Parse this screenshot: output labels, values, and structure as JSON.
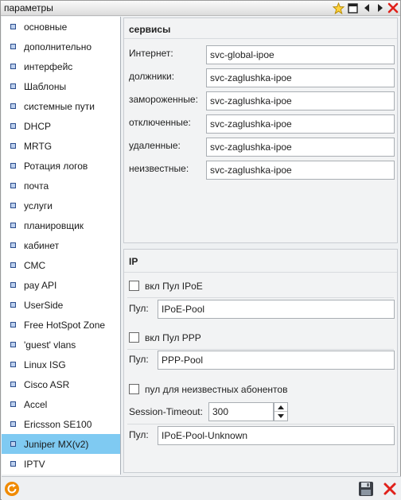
{
  "window": {
    "title": "параметры"
  },
  "sidebar": {
    "selected_index": 21,
    "items": [
      {
        "label": "основные"
      },
      {
        "label": "дополнительно"
      },
      {
        "label": "интерфейс"
      },
      {
        "label": "Шаблоны"
      },
      {
        "label": "системные пути"
      },
      {
        "label": "DHCP"
      },
      {
        "label": "MRTG"
      },
      {
        "label": "Ротация логов"
      },
      {
        "label": "почта"
      },
      {
        "label": "услуги"
      },
      {
        "label": "планировщик"
      },
      {
        "label": "кабинет"
      },
      {
        "label": "СМС"
      },
      {
        "label": "pay API"
      },
      {
        "label": "UserSide"
      },
      {
        "label": "Free HotSpot Zone"
      },
      {
        "label": "'guest' vlans"
      },
      {
        "label": "Linux ISG"
      },
      {
        "label": "Cisco ASR"
      },
      {
        "label": "Accel"
      },
      {
        "label": "Ericsson SE100"
      },
      {
        "label": "Juniper MX(v2)"
      },
      {
        "label": "IPTV"
      }
    ]
  },
  "services": {
    "title": "сервисы",
    "rows": [
      {
        "label": "Интернет:",
        "value": "svc-global-ipoe"
      },
      {
        "label": "должники:",
        "value": "svc-zaglushka-ipoe"
      },
      {
        "label": "замороженные:",
        "value": "svc-zaglushka-ipoe"
      },
      {
        "label": "отключенные:",
        "value": "svc-zaglushka-ipoe"
      },
      {
        "label": "удаленные:",
        "value": "svc-zaglushka-ipoe"
      },
      {
        "label": "неизвестные:",
        "value": "svc-zaglushka-ipoe"
      }
    ]
  },
  "ip": {
    "title": "IP",
    "ipoe_checkbox_label": "вкл Пул IPoE",
    "ipoe_checked": false,
    "ipoe_pool_label": "Пул:",
    "ipoe_pool_value": "IPoE-Pool",
    "ppp_checkbox_label": "вкл Пул PPP",
    "ppp_checked": false,
    "ppp_pool_label": "Пул:",
    "ppp_pool_value": "PPP-Pool",
    "unknown_checkbox_label": "пул для неизвестных абонентов",
    "unknown_checked": false,
    "session_timeout_label": "Session-Timeout:",
    "session_timeout_value": "300",
    "unknown_pool_label": "Пул:",
    "unknown_pool_value": "IPoE-Pool-Unknown"
  },
  "colors": {
    "selected_item_bg": "#7fcaf2",
    "close_red": "#e0211b",
    "refresh_orange": "#f08a00",
    "star_yellow": "#ffd23c"
  },
  "icons": {
    "titlebar": [
      "star-icon",
      "maximize-icon",
      "arrow-left-icon",
      "arrow-right-icon",
      "close-icon"
    ],
    "footer": [
      "refresh-icon",
      "save-icon",
      "cancel-icon"
    ]
  }
}
